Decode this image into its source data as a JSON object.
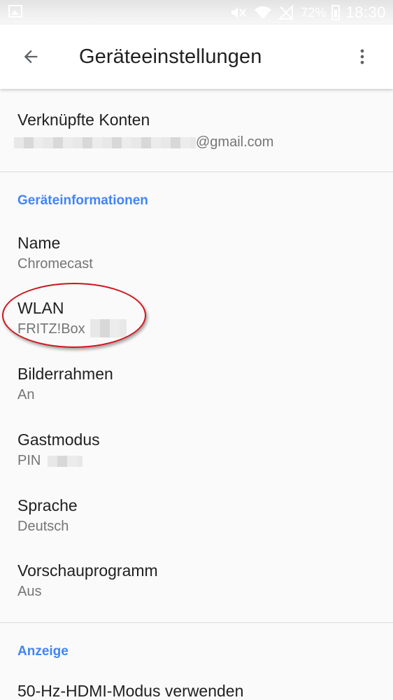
{
  "status_bar": {
    "battery_percent": "72%",
    "time": "18:30",
    "icons": [
      "gallery-icon",
      "mute-icon",
      "wifi-icon",
      "signal-off-icon",
      "battery-icon"
    ]
  },
  "app_bar": {
    "title": "Geräteeinstellungen",
    "back_icon": "arrow-back-icon",
    "menu_icon": "more-vert-icon"
  },
  "linked_accounts": {
    "title": "Verknüpfte Konten",
    "email_suffix": "@gmail.com"
  },
  "device_info": {
    "header": "Geräteinformationen",
    "items": [
      {
        "title": "Name",
        "value": "Chromecast"
      },
      {
        "title": "WLAN",
        "value": "FRITZ!Box"
      },
      {
        "title": "Bilderrahmen",
        "value": "An"
      },
      {
        "title": "Gastmodus",
        "value": "PIN"
      },
      {
        "title": "Sprache",
        "value": "Deutsch"
      },
      {
        "title": "Vorschauprogramm",
        "value": "Aus"
      }
    ]
  },
  "display": {
    "header": "Anzeige",
    "items": [
      {
        "title": "50-Hz-HDMI-Modus verwenden"
      }
    ]
  },
  "colors": {
    "accent": "#4285f4",
    "annotation": "#d0141b",
    "primary_text": "#212121",
    "secondary_text": "#757575"
  }
}
